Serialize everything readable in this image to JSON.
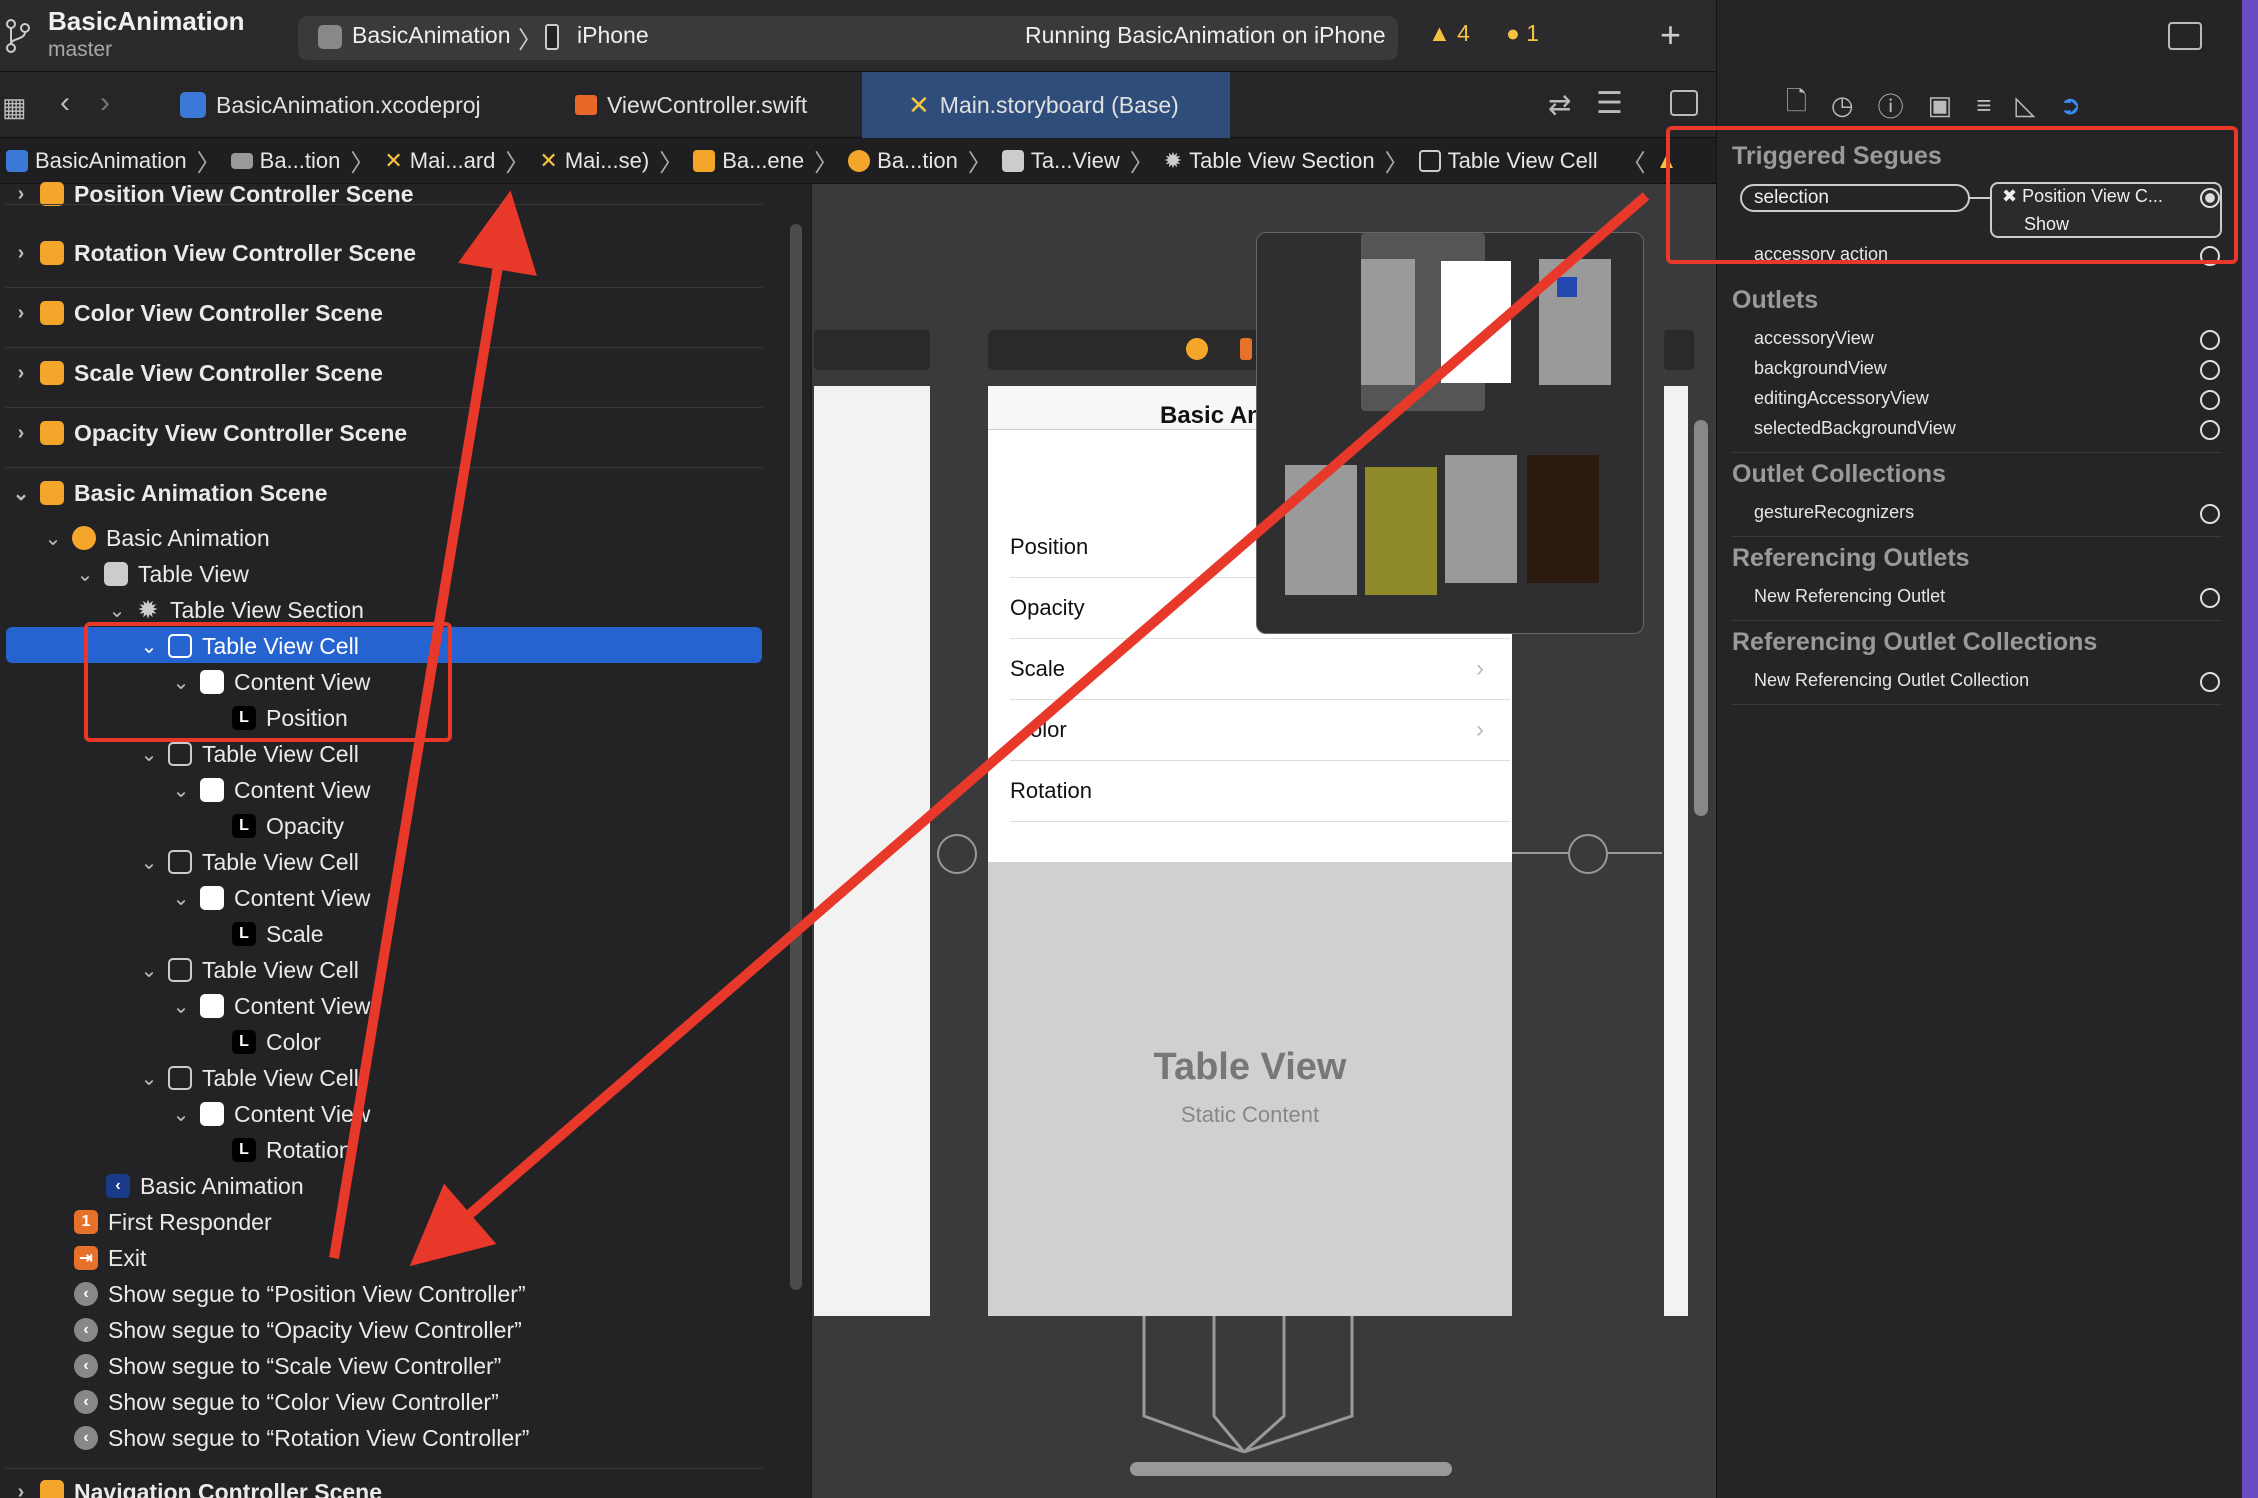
{
  "titlebar": {
    "project": "BasicAnimation",
    "branch": "master",
    "scheme": "BasicAnimation",
    "device": "iPhone",
    "status": "Running BasicAnimation on iPhone",
    "warnings": "4",
    "issues": "1"
  },
  "tabs": [
    {
      "label": "BasicAnimation.xcodeproj"
    },
    {
      "label": "ViewController.swift"
    },
    {
      "label": "Main.storyboard (Base)"
    }
  ],
  "breadcrumb": [
    "BasicAnimation",
    "Ba...tion",
    "Mai...ard",
    "Mai...se)",
    "Ba...ene",
    "Ba...tion",
    "Ta...View",
    "Table View Section",
    "Table View Cell"
  ],
  "navigator": {
    "top_partial": "Position View Controller Scene",
    "scenes": [
      "Rotation View Controller Scene",
      "Color View Controller Scene",
      "Scale View Controller Scene",
      "Opacity View Controller Scene",
      "Basic Animation Scene"
    ],
    "tree": {
      "controller": "Basic Animation",
      "table_view": "Table View",
      "section": "Table View Section",
      "cell": "Table View Cell",
      "content_view": "Content View",
      "labels": [
        "Position",
        "Opacity",
        "Scale",
        "Color",
        "Rotation"
      ],
      "label_glyph": "L",
      "exit_item": "Basic Animation",
      "first_responder": "First Responder",
      "exit": "Exit",
      "segues": [
        "Show segue to “Position View Controller”",
        "Show segue to “Opacity View Controller”",
        "Show segue to “Scale View Controller”",
        "Show segue to “Color View Controller”",
        "Show segue to “Rotation View Controller”"
      ],
      "bottom_partial": "Navigation Controller Scene"
    }
  },
  "canvas": {
    "nav_title": "Basic An",
    "cells": [
      "Position",
      "Opacity",
      "Scale",
      "olor",
      "Rotation"
    ],
    "table_title": "Table View",
    "table_subtitle": "Static Content"
  },
  "inspector": {
    "triggered_segues": "Triggered Segues",
    "selection": "selection",
    "segue_target": "Position View C...",
    "segue_kind": "Show",
    "accessory_action": "accessory action",
    "outlets_title": "Outlets",
    "outlets": [
      "accessoryView",
      "backgroundView",
      "editingAccessoryView",
      "selectedBackgroundView"
    ],
    "outlet_collections_title": "Outlet Collections",
    "outlet_collections": [
      "gestureRecognizers"
    ],
    "referencing_title": "Referencing Outlets",
    "referencing": [
      "New Referencing Outlet"
    ],
    "ref_collections_title": "Referencing Outlet Collections",
    "ref_collections": [
      "New Referencing Outlet Collection"
    ]
  },
  "colors": {
    "selection": "#2463d0",
    "annotation": "#e8382a",
    "scene_icon": "#f4a62a"
  }
}
